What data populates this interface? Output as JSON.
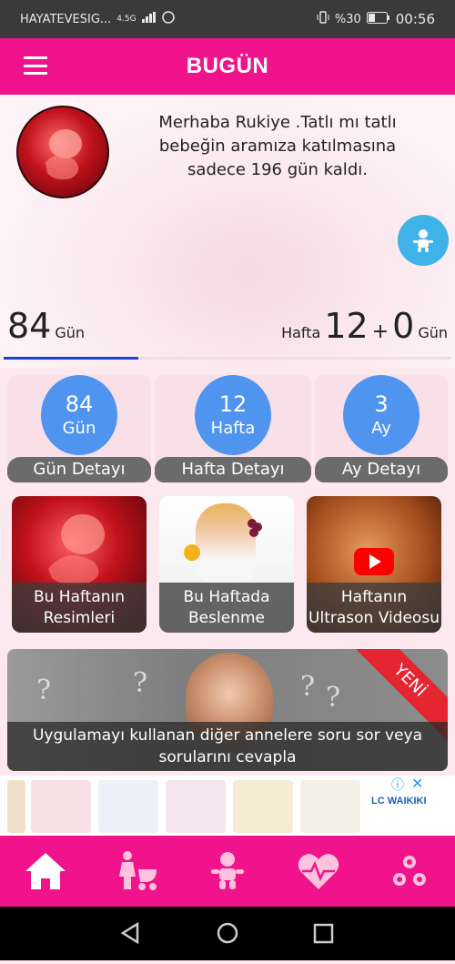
{
  "status_bar": {
    "carrier": "HAYATEVESIG...",
    "network": "4.5G",
    "battery": "%30",
    "time": "00:56"
  },
  "app_bar": {
    "title": "BUGÜN"
  },
  "greeting": "Merhaba Rukiye .Tatlı mı tatlı bebeğin aramıza katılmasına sadece 196 gün kaldı.",
  "counter": {
    "days": "84",
    "days_unit": "Gün",
    "week_label": "Hafta",
    "weeks": "12",
    "plus": "+",
    "extra_days": "0",
    "extra_unit": "Gün",
    "progress_fraction": 0.3
  },
  "stats": [
    {
      "value": "84",
      "unit": "Gün",
      "label": "Gün Detayı"
    },
    {
      "value": "12",
      "unit": "Hafta",
      "label": "Hafta Detayı"
    },
    {
      "value": "3",
      "unit": "Ay",
      "label": "Ay Detayı"
    }
  ],
  "tiles": [
    {
      "line1": "Bu Haftanın",
      "line2": "Resimleri"
    },
    {
      "line1": "Bu Haftada",
      "line2": "Beslenme"
    },
    {
      "line1": "Haftanın",
      "line2": "Ultrason Videosu"
    }
  ],
  "banner": {
    "ribbon": "YENİ",
    "line1": "Uygulamayı kullanan diğer annelere soru sor veya",
    "line2": "sorularını cevapla"
  },
  "ad": {
    "brand": "LC WAIKIKI"
  },
  "nav": [
    "home-icon",
    "mother-stroller-icon",
    "baby-icon",
    "heartbeat-icon",
    "settings-gears-icon"
  ],
  "colors": {
    "brand": "#f0138b",
    "stat_circle": "#4f95f0",
    "progress": "#1d3fd3",
    "fab": "#3fb2e8"
  }
}
